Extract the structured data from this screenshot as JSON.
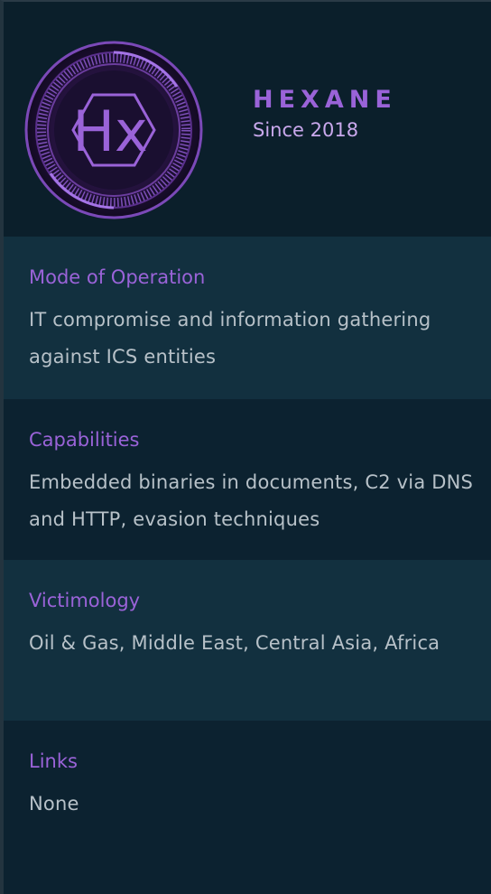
{
  "group": {
    "logo_text": "Hx",
    "name": "HEXANE",
    "since": "Since 2018"
  },
  "sections": [
    {
      "label": "Mode of Operation",
      "value": "IT compromise and information gathering against ICS entities"
    },
    {
      "label": "Capabilities",
      "value": "Embedded binaries in documents, C2 via DNS and HTTP, evasion techniques"
    },
    {
      "label": "Victimology",
      "value": "Oil & Gas, Middle East, Central Asia, Africa"
    },
    {
      "label": "Links",
      "value": "None"
    }
  ],
  "colors": {
    "background": "#0b1f2b",
    "accent": "#9a63d8",
    "text": "#b7c1c8",
    "band_light": "#12303f",
    "band_dark": "#0c2230"
  }
}
